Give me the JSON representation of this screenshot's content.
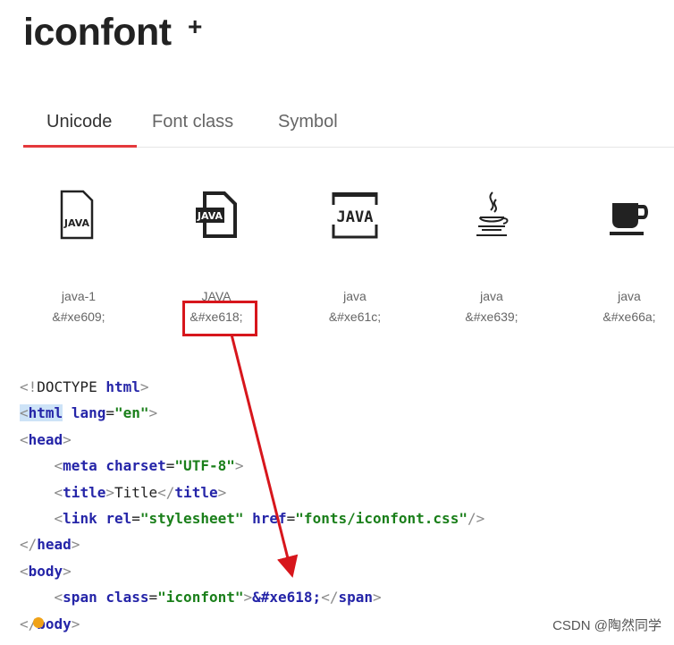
{
  "logo": {
    "text": "iconfont",
    "plus": "+"
  },
  "tabs": [
    {
      "label": "Unicode",
      "active": true
    },
    {
      "label": "Font class",
      "active": false
    },
    {
      "label": "Symbol",
      "active": false
    }
  ],
  "icons": [
    {
      "name": "java-1",
      "code": "&#xe609;",
      "icon": "java-file-outline-icon"
    },
    {
      "name": "JAVA",
      "code": "&#xe618;",
      "icon": "java-file-filled-icon"
    },
    {
      "name": "java",
      "code": "&#xe61c;",
      "icon": "java-text-bracket-icon"
    },
    {
      "name": "java",
      "code": "&#xe639;",
      "icon": "java-coffee-steam-icon"
    },
    {
      "name": "java",
      "code": "&#xe66a;",
      "icon": "coffee-cup-icon"
    }
  ],
  "code": {
    "doctype": {
      "a": "<!",
      "b": "DOCTYPE",
      "c": "html",
      "d": ">"
    },
    "html_open": {
      "a": "<",
      "tag": "html",
      "attr": "lang",
      "eq": "=",
      "val": "\"en\"",
      "close": ">"
    },
    "head_open": {
      "a": "<",
      "tag": "head",
      "close": ">"
    },
    "meta": {
      "a": "<",
      "tag": "meta",
      "attr": "charset",
      "eq": "=",
      "val": "\"UTF-8\"",
      "close": ">"
    },
    "title": {
      "a": "<",
      "tag": "title",
      "b": ">",
      "text": "Title",
      "c": "</",
      "tag2": "title",
      "d": ">"
    },
    "link": {
      "a": "<",
      "tag": "link",
      "attr1": "rel",
      "eq1": "=",
      "val1": "\"stylesheet\"",
      "attr2": "href",
      "eq2": "=",
      "val2": "\"fonts/iconfont.css\"",
      "close": "/>"
    },
    "head_close": {
      "a": "</",
      "tag": "head",
      "close": ">"
    },
    "body_open": {
      "a": "<",
      "tag": "body",
      "close": ">"
    },
    "span": {
      "a": "<",
      "tag": "span",
      "attr": "class",
      "eq": "=",
      "val": "\"iconfont\"",
      "b": ">",
      "text": "&#xe618;",
      "c": "</",
      "tag2": "span",
      "d": ">"
    },
    "body_close": {
      "a": "</",
      "tag": "body",
      "close": ">"
    }
  },
  "watermark": "CSDN @陶然同学",
  "colors": {
    "accent_red": "#e4393c",
    "annotation_red": "#d7161c"
  }
}
